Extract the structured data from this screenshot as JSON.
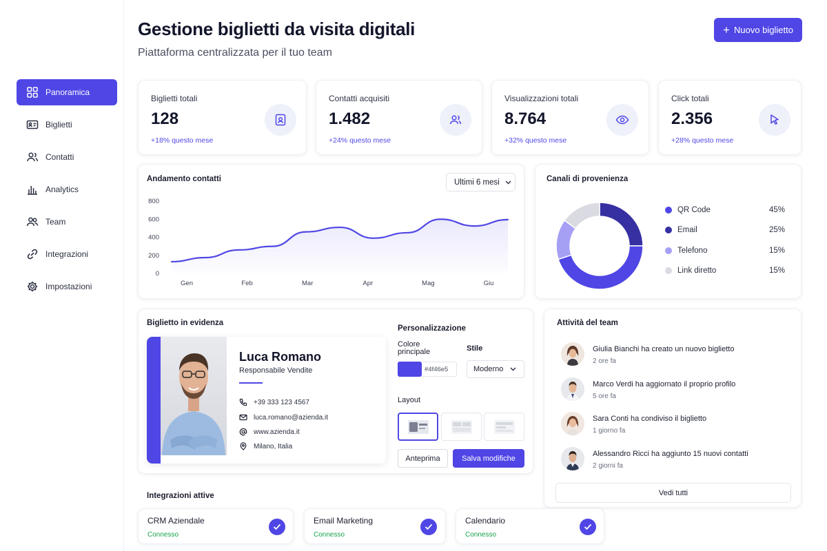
{
  "header": {
    "title": "Gestione biglietti da visita digitali",
    "subtitle": "Piattaforma centralizzata per il tuo team",
    "new_button": "Nuovo biglietto",
    "new_button_icon": "plus-icon"
  },
  "sidebar": {
    "items": [
      {
        "label": "Panoramica",
        "icon": "grid-icon",
        "active": true
      },
      {
        "label": "Biglietti",
        "icon": "id-card-icon"
      },
      {
        "label": "Contatti",
        "icon": "users-icon"
      },
      {
        "label": "Analytics",
        "icon": "bar-chart-icon"
      },
      {
        "label": "Team",
        "icon": "team-icon"
      },
      {
        "label": "Integrazioni",
        "icon": "link-icon"
      },
      {
        "label": "Impostazioni",
        "icon": "gear-icon"
      }
    ]
  },
  "kpis": [
    {
      "label": "Biglietti totali",
      "value": "128",
      "trend": "+18% questo mese",
      "icon": "badge-icon"
    },
    {
      "label": "Contatti acquisiti",
      "value": "1.482",
      "trend": "+24% questo mese",
      "icon": "users-icon"
    },
    {
      "label": "Visualizzazioni totali",
      "value": "8.764",
      "trend": "+32% questo mese",
      "icon": "eye-icon"
    },
    {
      "label": "Click totali",
      "value": "2.356",
      "trend": "+28% questo mese",
      "icon": "cursor-icon"
    }
  ],
  "trend_chart": {
    "title": "Andamento contatti",
    "range_select": "Ultimi 6 mesi"
  },
  "channels": {
    "title": "Canali di provenienza"
  },
  "chart_data": [
    {
      "type": "area",
      "title": "Andamento contatti",
      "categories": [
        "Gen",
        "Feb",
        "Mar",
        "Apr",
        "Mag",
        "Giu"
      ],
      "x": [
        0,
        0.5,
        1,
        1.5,
        2,
        2.5,
        3,
        3.5,
        4,
        4.5,
        5
      ],
      "yticks": [
        0,
        200,
        400,
        600,
        800
      ],
      "ylim": [
        0,
        800
      ],
      "series": [
        {
          "values": [
            130,
            175,
            260,
            300,
            460,
            510,
            390,
            450,
            600,
            525,
            595
          ]
        }
      ],
      "color": "#4f46e5",
      "grid": false
    },
    {
      "type": "pie",
      "title": "Canali di provenienza",
      "donut": true,
      "labels": [
        "QR Code",
        "Email",
        "Telefono",
        "Link diretto"
      ],
      "values": [
        45,
        25,
        15,
        15
      ],
      "display": [
        "45%",
        "25%",
        "15%",
        "15%"
      ],
      "colors": [
        "#4f46e5",
        "#3730a3",
        "#a5a0f3",
        "#d9dae2"
      ]
    }
  ],
  "featured_card": {
    "title": "Biglietto in evidenza",
    "name": "Luca Romano",
    "role": "Responsabile Vendite",
    "phone": "+39 333 123 4567",
    "email": "luca.romano@azienda.it",
    "website": "www.azienda.it",
    "location": "Milano, Italia"
  },
  "customization": {
    "title": "Personalizzazione",
    "color_label": "Colore principale",
    "color_value": "#4f46e5",
    "style_label": "Stile",
    "style_value": "Moderno",
    "layout_label": "Layout",
    "preview_button": "Anteprima",
    "save_button": "Salva modifiche"
  },
  "activity": {
    "title": "Attività del team",
    "items": [
      {
        "text": "Giulia Bianchi ha creato un nuovo biglietto",
        "time": "2 ore fa"
      },
      {
        "text": "Marco Verdi ha aggiornato il proprio profilo",
        "time": "5 ore fa"
      },
      {
        "text": "Sara Conti ha condiviso il biglietto",
        "time": "1 giorno fa"
      },
      {
        "text": "Alessandro Ricci ha aggiunto 15 nuovi contatti",
        "time": "2 giorni fa"
      }
    ],
    "see_all": "Vedi tutti"
  },
  "integrations": {
    "title": "Integrazioni attive",
    "items": [
      {
        "name": "CRM Aziendale",
        "status": "Connesso"
      },
      {
        "name": "Email Marketing",
        "status": "Connesso"
      },
      {
        "name": "Calendario",
        "status": "Connesso"
      }
    ]
  },
  "colors": {
    "accent": "#4f46e5",
    "success": "#16a34a"
  }
}
